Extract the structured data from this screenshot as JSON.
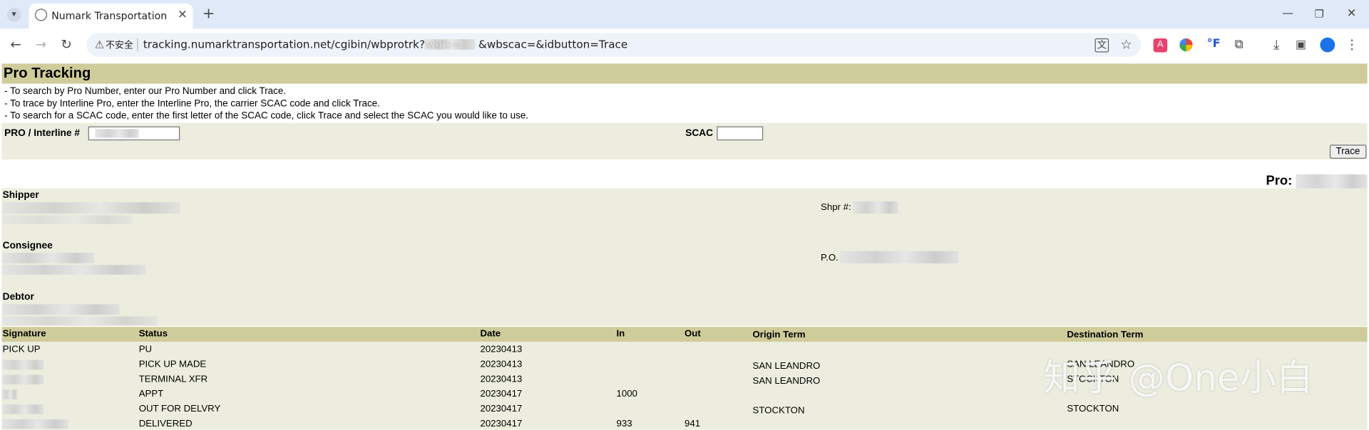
{
  "browser": {
    "tab_title": "Numark Transportation",
    "security_label": "不安全",
    "url": "tracking.numarktransportation.net/cgibin/wbprotrk?wbfb=",
    "url_tail": "&wbscac=&idbutton=Trace"
  },
  "page": {
    "title": "Pro Tracking",
    "instructions": [
      "- To search by Pro Number, enter our Pro Number and click Trace.",
      "- To trace by Interline Pro, enter the Interline Pro, the carrier SCAC code and click Trace.",
      "- To search for a SCAC code, enter the first letter of the SCAC code, click Trace and select the SCAC you would like to use."
    ],
    "form": {
      "pro_label": "PRO / Interline #",
      "scac_label": "SCAC",
      "trace_button": "Trace"
    },
    "pro_label": "Pro:",
    "shipper_label": "Shipper",
    "shipper_ref_label": "Shpr #:",
    "consignee_label": "Consignee",
    "po_label": "P.O.",
    "debtor_label": "Debtor"
  },
  "table": {
    "headers": [
      "Signature",
      "Status",
      "Date",
      "In",
      "Out",
      "Origin Term",
      "Destination Term"
    ],
    "rows": [
      {
        "signature": "PICK UP",
        "status": "PU",
        "date": "20230413",
        "in": "",
        "out": "",
        "origin": "",
        "destination": ""
      },
      {
        "signature": "",
        "status": "PICK UP MADE",
        "date": "20230413",
        "in": "",
        "out": "",
        "origin": "SAN LEANDRO",
        "destination": "SAN LEANDRO"
      },
      {
        "signature": "",
        "status": "TERMINAL XFR",
        "date": "20230413",
        "in": "",
        "out": "",
        "origin": "SAN LEANDRO",
        "destination": "STOCKTON"
      },
      {
        "signature": "",
        "status": "APPT",
        "date": "20230417",
        "in": "1000",
        "out": "",
        "origin": "",
        "destination": ""
      },
      {
        "signature": "",
        "status": "OUT FOR DELVRY",
        "date": "20230417",
        "in": "",
        "out": "",
        "origin": "STOCKTON",
        "destination": "STOCKTON"
      },
      {
        "signature": "",
        "status": "DELIVERED",
        "date": "20230417",
        "in": "933",
        "out": "941",
        "origin": "",
        "destination": ""
      }
    ]
  },
  "watermark": "知乎 @One小白"
}
